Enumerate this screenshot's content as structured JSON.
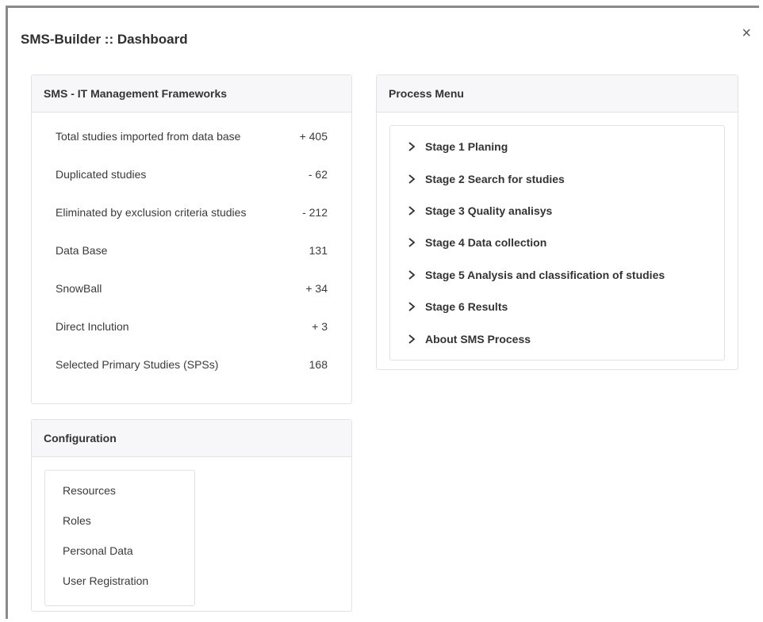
{
  "app": {
    "title": "SMS-Builder :: Dashboard",
    "close_symbol": "×"
  },
  "sms_panel": {
    "header": "SMS - IT Management Frameworks",
    "rows": [
      {
        "label": "Total studies imported from data base",
        "value": "+ 405"
      },
      {
        "label": "Duplicated studies",
        "value": "- 62"
      },
      {
        "label": "Eliminated by exclusion criteria studies",
        "value": "- 212"
      },
      {
        "label": "Data Base",
        "value": "131"
      },
      {
        "label": "SnowBall",
        "value": "+ 34"
      },
      {
        "label": "Direct Inclution",
        "value": "+ 3"
      },
      {
        "label": "Selected Primary Studies (SPSs)",
        "value": "168"
      }
    ]
  },
  "process_menu": {
    "header": "Process Menu",
    "icon": "chevron-right-icon",
    "items": [
      {
        "label": "Stage 1 Planing"
      },
      {
        "label": "Stage 2 Search for studies"
      },
      {
        "label": "Stage 3 Quality analisys"
      },
      {
        "label": "Stage 4 Data collection"
      },
      {
        "label": "Stage 5 Analysis and classification of studies"
      },
      {
        "label": "Stage 6 Results"
      },
      {
        "label": "About SMS Process"
      }
    ]
  },
  "configuration": {
    "header": "Configuration",
    "items": [
      {
        "label": "Resources"
      },
      {
        "label": "Roles"
      },
      {
        "label": "Personal Data"
      },
      {
        "label": "User Registration"
      }
    ]
  }
}
